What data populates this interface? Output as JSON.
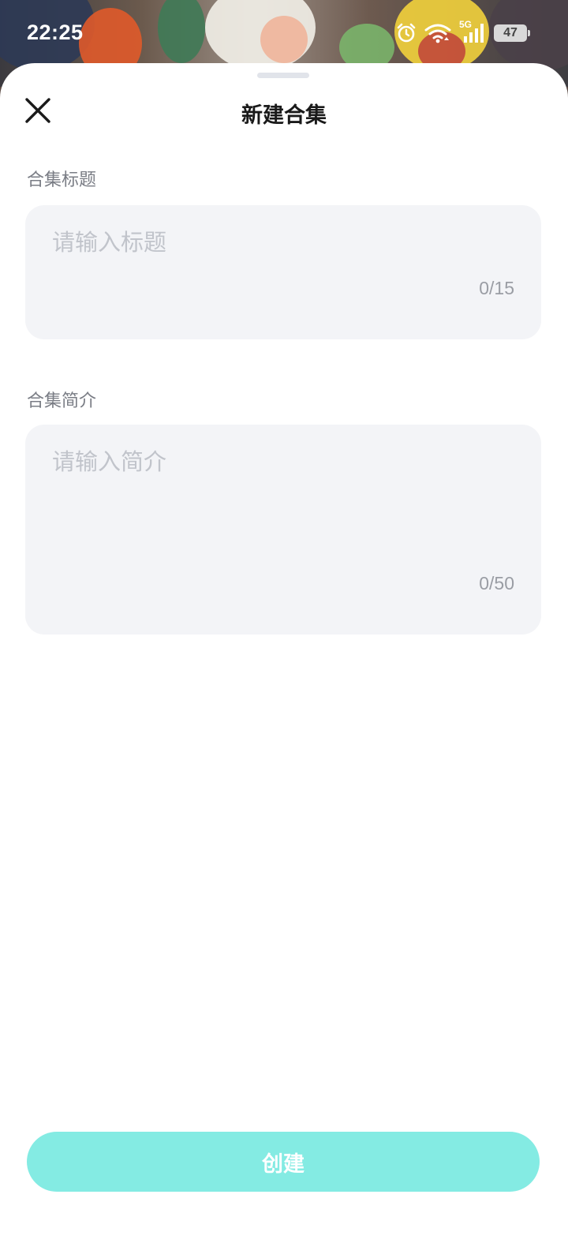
{
  "status_bar": {
    "time": "22:25",
    "network": "5G",
    "battery": "47",
    "icons": [
      "alarm-icon",
      "wifi-icon",
      "signal-icon",
      "battery-icon"
    ]
  },
  "sheet": {
    "title": "新建合集",
    "close_icon": "close-icon"
  },
  "form": {
    "title_field": {
      "label": "合集标题",
      "placeholder": "请输入标题",
      "value": "",
      "counter": "0/15"
    },
    "intro_field": {
      "label": "合集简介",
      "placeholder": "请输入简介",
      "value": "",
      "counter": "0/50"
    }
  },
  "actions": {
    "create_label": "创建"
  },
  "colors": {
    "accent": "#84ebe3",
    "input_bg": "#f3f4f7",
    "placeholder": "#c1c4cb",
    "label": "#7a7d85"
  }
}
